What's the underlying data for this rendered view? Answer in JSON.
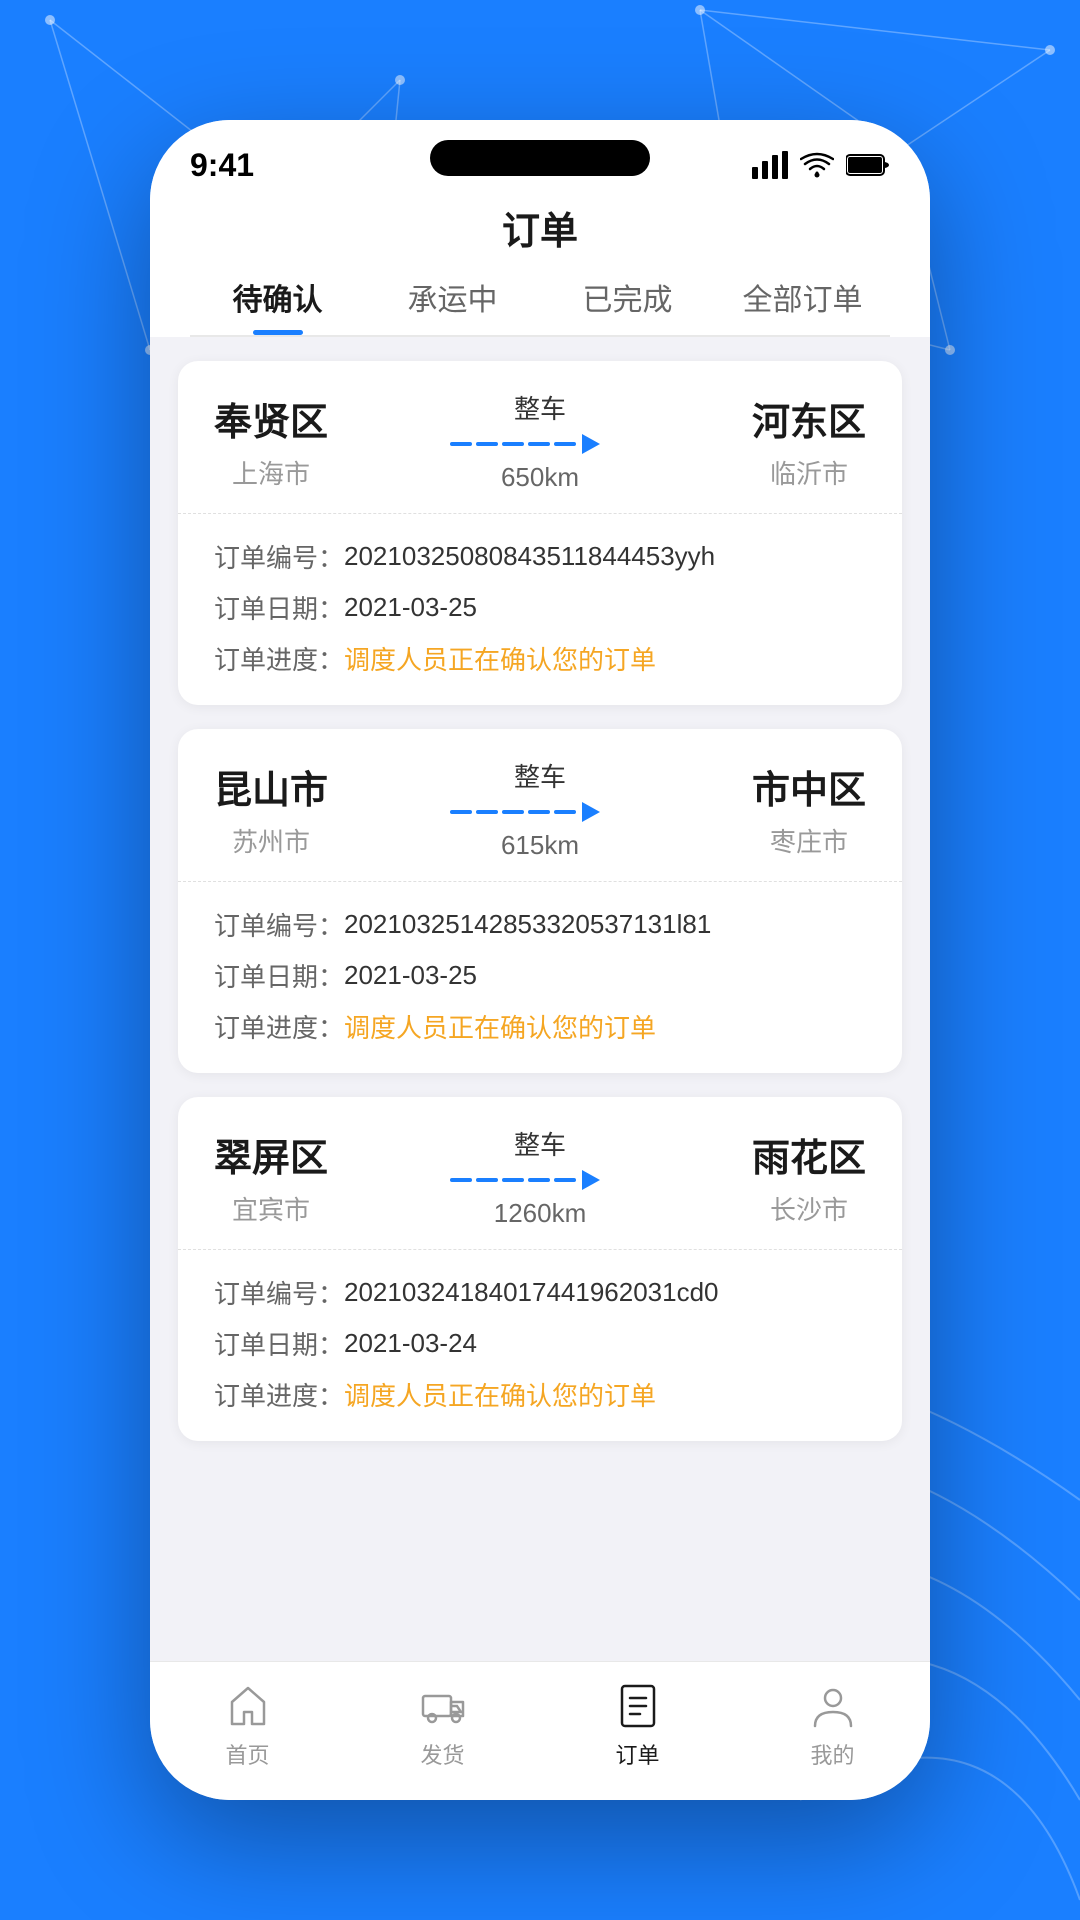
{
  "background": {
    "color": "#1a7fff"
  },
  "status_bar": {
    "time": "9:41",
    "signal": "▲",
    "wifi": "wifi",
    "battery": "battery"
  },
  "page_title": "订单",
  "tabs": [
    {
      "id": "pending",
      "label": "待确认",
      "active": true
    },
    {
      "id": "in_transit",
      "label": "承运中",
      "active": false
    },
    {
      "id": "completed",
      "label": "已完成",
      "active": false
    },
    {
      "id": "all",
      "label": "全部订单",
      "active": false
    }
  ],
  "orders": [
    {
      "from_city": "奉贤区",
      "from_district": "上海市",
      "to_city": "河东区",
      "to_district": "临沂市",
      "route_type": "整车",
      "distance": "650km",
      "order_no_label": "订单编号：",
      "order_no": "20210325080843511844453yyh",
      "order_date_label": "订单日期：",
      "order_date": "2021-03-25",
      "order_progress_label": "订单进度：",
      "order_progress": "调度人员正在确认您的订单"
    },
    {
      "from_city": "昆山市",
      "from_district": "苏州市",
      "to_city": "市中区",
      "to_district": "枣庄市",
      "route_type": "整车",
      "distance": "615km",
      "order_no_label": "订单编号：",
      "order_no": "20210325142853320537131l81",
      "order_date_label": "订单日期：",
      "order_date": "2021-03-25",
      "order_progress_label": "订单进度：",
      "order_progress": "调度人员正在确认您的订单"
    },
    {
      "from_city": "翠屏区",
      "from_district": "宜宾市",
      "to_city": "雨花区",
      "to_district": "长沙市",
      "route_type": "整车",
      "distance": "1260km",
      "order_no_label": "订单编号：",
      "order_no": "20210324184017441962031cd0",
      "order_date_label": "订单日期：",
      "order_date": "2021-03-24",
      "order_progress_label": "订单进度：",
      "order_progress": "调度人员正在确认您的订单"
    }
  ],
  "bottom_nav": [
    {
      "id": "home",
      "label": "首页",
      "active": false,
      "icon": "home"
    },
    {
      "id": "shipping",
      "label": "发货",
      "active": false,
      "icon": "truck"
    },
    {
      "id": "orders",
      "label": "订单",
      "active": true,
      "icon": "orders"
    },
    {
      "id": "profile",
      "label": "我的",
      "active": false,
      "icon": "profile"
    }
  ]
}
